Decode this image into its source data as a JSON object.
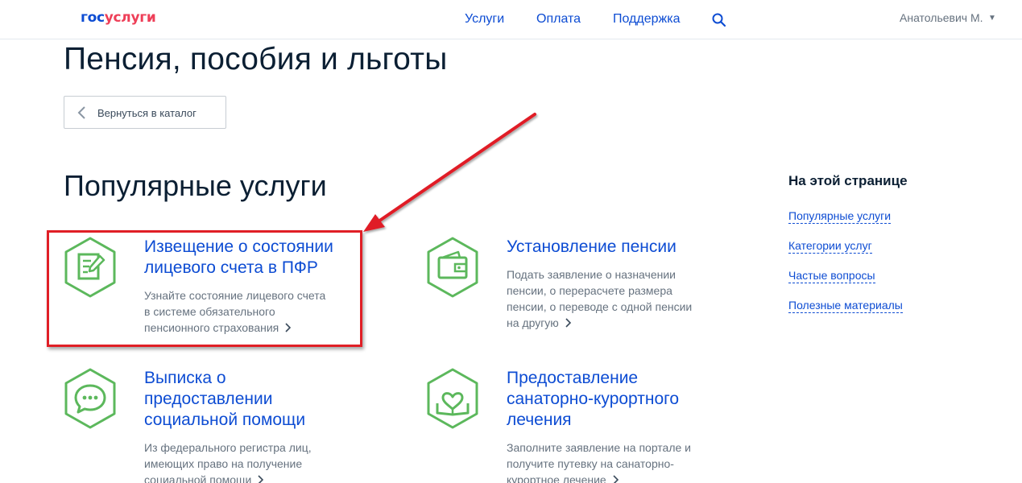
{
  "header": {
    "logo_gos": "гос",
    "logo_uslugi": "услуги",
    "nav": [
      "Услуги",
      "Оплата",
      "Поддержка"
    ],
    "user_name": "Анатольевич М.",
    "user_caret": "▼"
  },
  "page_title": "Пенсия, пособия и льготы",
  "back_button": "Вернуться в каталог",
  "section_title": "Популярные услуги",
  "services": [
    {
      "title_lines": [
        "Извещение о состоянии",
        "лицевого счета в ПФР"
      ],
      "desc_lines": [
        "Узнайте состояние лицевого счета",
        "в системе обязательного",
        "пенсионного страхования"
      ],
      "icon": "document-edit-icon"
    },
    {
      "title_lines": [
        "Установление пенсии"
      ],
      "desc_lines": [
        "Подать заявление о назначении",
        "пенсии, о перерасчете размера",
        "пенсии, о переводе с одной пенсии",
        "на другую"
      ],
      "icon": "wallet-icon"
    },
    {
      "title_lines": [
        "Выписка о",
        "предоставлении",
        "социальной помощи"
      ],
      "desc_lines": [
        "Из федерального регистра лиц,",
        "имеющих право на получение",
        "социальной помощи"
      ],
      "icon": "chat-bubble-icon"
    },
    {
      "title_lines": [
        "Предоставление",
        "санаторно-курортного",
        "лечения"
      ],
      "desc_lines": [
        "Заполните заявление на портале и",
        "получите путевку на санаторно-",
        "курортное лечение"
      ],
      "icon": "heart-book-icon"
    }
  ],
  "aside": {
    "title": "На этой странице",
    "links": [
      "Популярные услуги",
      "Категории услуг",
      "Частые вопросы",
      "Полезные материалы"
    ]
  },
  "colors": {
    "link_blue": "#0d4cd3",
    "icon_green": "#5cb85c",
    "highlight_red": "#e01f26",
    "logo_red": "#ee3f58"
  }
}
